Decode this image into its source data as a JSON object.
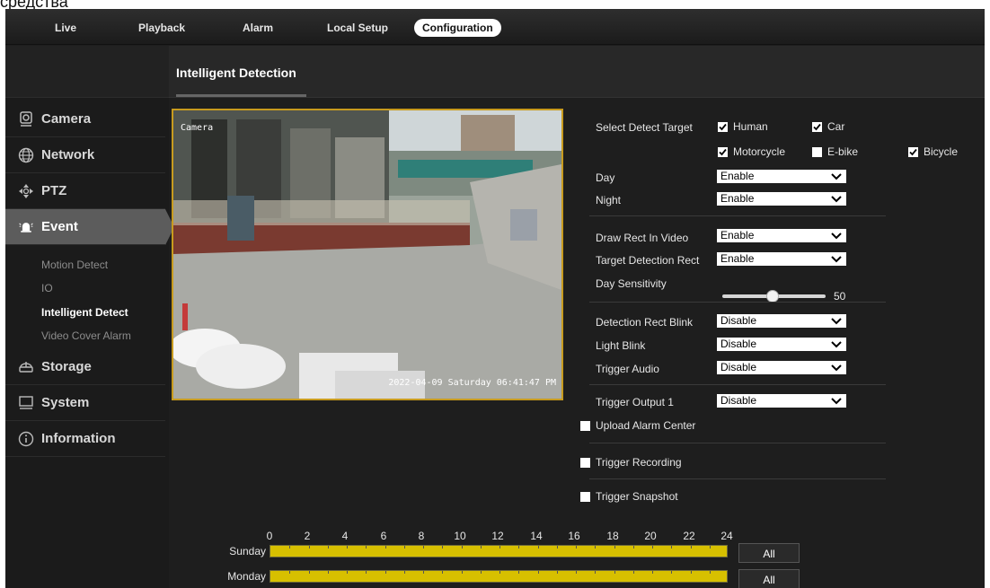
{
  "caption": "средства",
  "topnav": {
    "tabs": [
      {
        "label": "Live"
      },
      {
        "label": "Playback"
      },
      {
        "label": "Alarm"
      },
      {
        "label": "Local Setup"
      },
      {
        "label": "Configuration",
        "active": true
      }
    ]
  },
  "sidebar": {
    "items": [
      {
        "label": "Camera",
        "icon": "camera-icon"
      },
      {
        "label": "Network",
        "icon": "globe-icon"
      },
      {
        "label": "PTZ",
        "icon": "ptz-icon"
      },
      {
        "label": "Event",
        "icon": "alarm-bell-icon",
        "active": true
      },
      {
        "label": "Storage",
        "icon": "storage-icon"
      },
      {
        "label": "System",
        "icon": "monitor-icon"
      },
      {
        "label": "Information",
        "icon": "info-icon"
      }
    ],
    "event_sub": [
      {
        "label": "Motion Detect"
      },
      {
        "label": "IO"
      },
      {
        "label": "Intelligent Detect",
        "active": true
      },
      {
        "label": "Video Cover Alarm"
      }
    ]
  },
  "page": {
    "title": "Intelligent Detection"
  },
  "video": {
    "camera_label": "Camera",
    "timestamp": "2022-04-09 Saturday 06:41:47 PM"
  },
  "settings": {
    "select_detect_target_label": "Select Detect Target",
    "targets": [
      {
        "label": "Human",
        "checked": true
      },
      {
        "label": "Car",
        "checked": true
      },
      {
        "label": "Motorcycle",
        "checked": true
      },
      {
        "label": "E-bike",
        "checked": false
      },
      {
        "label": "Bicycle",
        "checked": true
      }
    ],
    "day_label": "Day",
    "day_value": "Enable",
    "night_label": "Night",
    "night_value": "Enable",
    "draw_rect_label": "Draw Rect In Video",
    "draw_rect_value": "Enable",
    "target_rect_label": "Target Detection Rect",
    "target_rect_value": "Enable",
    "day_sensitivity_label": "Day Sensitivity",
    "day_sensitivity_value": "50",
    "rect_blink_label": "Detection Rect Blink",
    "rect_blink_value": "Disable",
    "light_blink_label": "Light Blink",
    "light_blink_value": "Disable",
    "trigger_audio_label": "Trigger Audio",
    "trigger_audio_value": "Disable",
    "trigger_output_label": "Trigger Output 1",
    "trigger_output_value": "Disable",
    "upload_alarm_label": "Upload Alarm Center",
    "upload_alarm_checked": false,
    "trigger_recording_label": "Trigger Recording",
    "trigger_recording_checked": false,
    "trigger_snapshot_label": "Trigger Snapshot",
    "trigger_snapshot_checked": false
  },
  "schedule": {
    "hours": [
      "0",
      "2",
      "4",
      "6",
      "8",
      "10",
      "12",
      "14",
      "16",
      "18",
      "20",
      "22",
      "24"
    ],
    "days": [
      {
        "label": "Sunday",
        "all_label": "All"
      },
      {
        "label": "Monday",
        "all_label": "All"
      }
    ]
  },
  "colors": {
    "accent_frame": "#c89b1e",
    "schedule_fill": "#d7c000",
    "active_sidebar": "#5c5c5c"
  }
}
